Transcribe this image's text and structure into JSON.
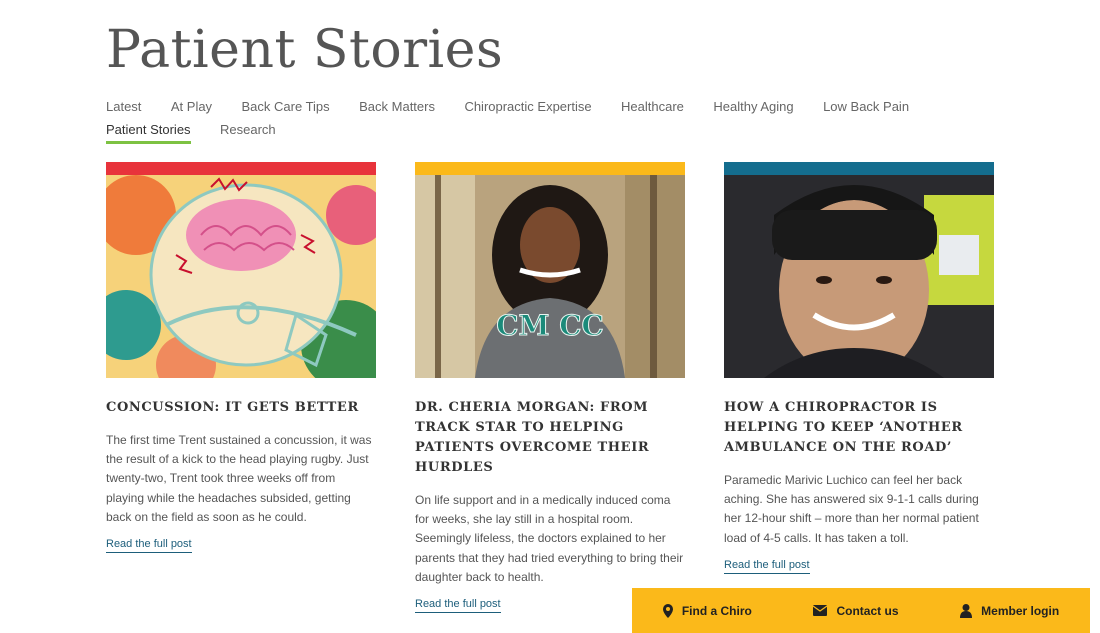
{
  "page": {
    "title": "Patient Stories"
  },
  "nav": {
    "items": [
      {
        "label": "Latest"
      },
      {
        "label": "At Play"
      },
      {
        "label": "Back Care Tips"
      },
      {
        "label": "Back Matters"
      },
      {
        "label": "Chiropractic Expertise"
      },
      {
        "label": "Healthcare"
      },
      {
        "label": "Healthy Aging"
      },
      {
        "label": "Low Back Pain"
      },
      {
        "label": "Patient Stories",
        "active": true
      },
      {
        "label": "Research"
      }
    ]
  },
  "cards": [
    {
      "accent": "#e8333b",
      "title": "Concussion: It gets better",
      "excerpt": "The first time Trent sustained a concussion, it was the result of a kick to the head playing rugby. Just twenty-two, Trent took three weeks off from playing while the headaches subsided, getting back on the field as soon as he could.",
      "link": "Read the full post"
    },
    {
      "accent": "#fbb91a",
      "title": "Dr. Cheria Morgan: From track star to helping patients overcome their hurdles",
      "excerpt": "On life support and in a medically induced coma for weeks, she lay still in a hospital room. Seemingly lifeless, the doctors explained to her parents that they had tried everything to bring their daughter back to health.",
      "link": "Read the full post"
    },
    {
      "accent": "#146d8e",
      "title": "How a chiropractor is helping to keep ‘another ambulance on the road’",
      "excerpt": "Paramedic Marivic Luchico can feel her back aching. She has answered six 9-1-1 calls during her 12-hour shift – more than her normal patient load of 4-5 calls. It has taken a toll.",
      "link": "Read the full post"
    }
  ],
  "footer": {
    "find": "Find a Chiro",
    "contact": "Contact us",
    "login": "Member login",
    "color": "#fbb91a"
  }
}
